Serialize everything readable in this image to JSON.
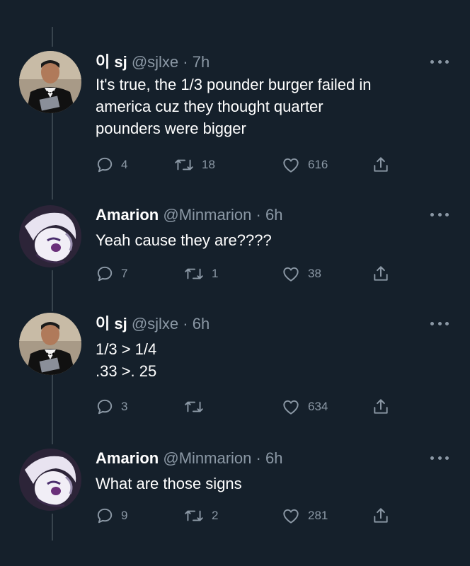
{
  "tweets": [
    {
      "name": "이 sj",
      "handle": "@sjlxe",
      "dot": "·",
      "time": "7h",
      "lines": [
        "It's true, the 1/3 pounder burger failed in",
        "america cuz they thought quarter",
        "pounders were bigger"
      ],
      "replies": "4",
      "retweets": "18",
      "likes": "616",
      "avatar_icon": "man-in-tuxedo-avatar"
    },
    {
      "name": "Amarion",
      "handle": "@Minmarion",
      "dot": "·",
      "time": "6h",
      "lines": [
        "Yeah cause they are????"
      ],
      "replies": "7",
      "retweets": "1",
      "likes": "38",
      "avatar_icon": "anime-character-avatar"
    },
    {
      "name": "이 sj",
      "handle": "@sjlxe",
      "dot": "·",
      "time": "6h",
      "lines": [
        "1/3 > 1/4",
        ".33 >. 25"
      ],
      "replies": "3",
      "retweets": "",
      "likes": "634",
      "avatar_icon": "man-in-tuxedo-avatar"
    },
    {
      "name": "Amarion",
      "handle": "@Minmarion",
      "dot": "·",
      "time": "6h",
      "lines": [
        "What are those signs"
      ],
      "replies": "9",
      "retweets": "2",
      "likes": "281",
      "avatar_icon": "anime-character-avatar"
    }
  ],
  "colors": {
    "background": "#15202b",
    "text": "#ffffff",
    "muted": "#8b98a5",
    "thread_line": "#38444d"
  },
  "icons": [
    "reply-icon",
    "retweet-icon",
    "like-icon",
    "share-icon",
    "more-options-icon"
  ]
}
